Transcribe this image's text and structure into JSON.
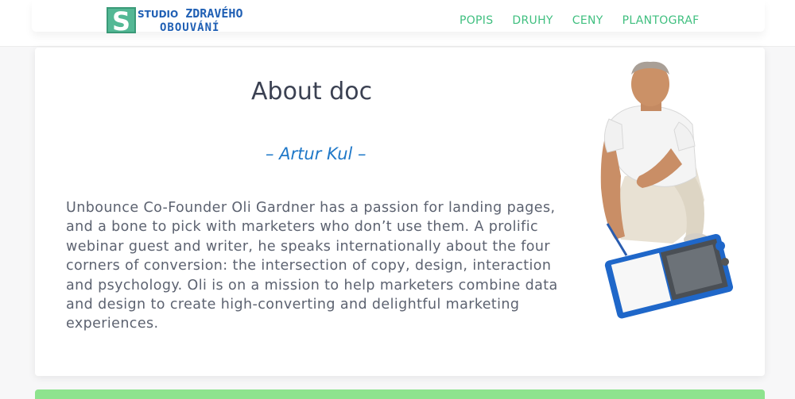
{
  "header": {
    "logo_letter": "S",
    "logo_line1_small": "STUDIO",
    "logo_line1": "ZDRAVÉHO",
    "logo_line2": "OBOUVÁNÍ",
    "nav": [
      "POPIS",
      "DRUHY",
      "CENY",
      "PLANTOGRAF"
    ]
  },
  "main": {
    "title": "About doc",
    "subtitle": "– Artur Kul –",
    "bio": "Unbounce Co-Founder Oli Gardner has a passion for landing pages, and a bone to pick with marketers who don’t use them. A prolific webinar guest and writer, he speaks internationally about the four corners of conversion: the intersection of copy, design, interaction and psychology. Oli is on a mission to help marketers combine data and design to create high-converting and delightful marketing experiences."
  },
  "colors": {
    "accent": "#3fbf7f",
    "logo_green": "#54b895",
    "logo_blue": "#1f5fb4",
    "subtitle_blue": "#1f78c8",
    "bottom_bar": "#8ee38e"
  }
}
